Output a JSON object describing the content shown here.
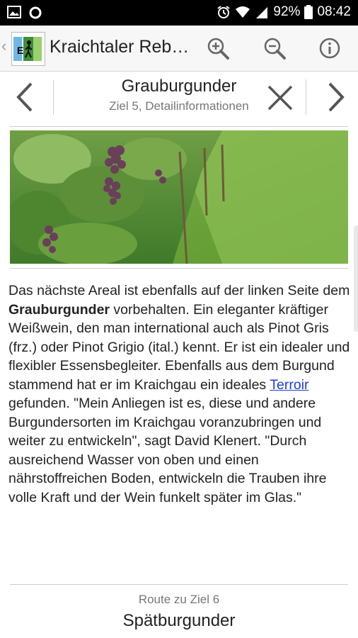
{
  "statusbar": {
    "battery": "92%",
    "time": "08:42"
  },
  "appbar": {
    "title": "Kraichtaler Reb…"
  },
  "detail": {
    "title": "Grauburgunder",
    "subtitle": "Ziel 5, Detailinformationen"
  },
  "article": {
    "part1": "Das nächste Areal ist ebenfalls auf der linken Seite dem ",
    "bold": "Grauburgunder",
    "part2": " vorbehalten. Ein eleganter kräftiger Weißwein, den man international auch als Pinot Gris (frz.) oder Pinot Grigio (ital.) kennt. Er ist ein idealer und flexibler Essensbegleiter. Ebenfalls aus dem Burgund stammend hat er im Kraichgau ein ideales ",
    "link": "Terroir ",
    "part3": "gefunden. \"Mein Anliegen ist es, diese und andere Burgundersorten im Kraichgau voranzubringen und weiter zu entwickeln\", sagt David Klenert. \"Durch ausreichend Wasser von oben und einen nährstoffreichen Boden, entwickeln die Trauben ihre volle Kraft und der Wein funkelt später im Glas.\""
  },
  "next_route": {
    "label": "Route zu Ziel 6",
    "name": "Spätburgunder"
  },
  "colors": {
    "link": "#1a3fd6",
    "statusbar_bg": "#000000",
    "appbar_bg": "#f7f7f7"
  },
  "icons": {
    "zoom_in": "zoom-in-icon",
    "zoom_out": "zoom-out-icon",
    "info": "info-icon",
    "prev": "chevron-left-icon",
    "next": "chevron-right-icon",
    "close": "close-icon"
  }
}
